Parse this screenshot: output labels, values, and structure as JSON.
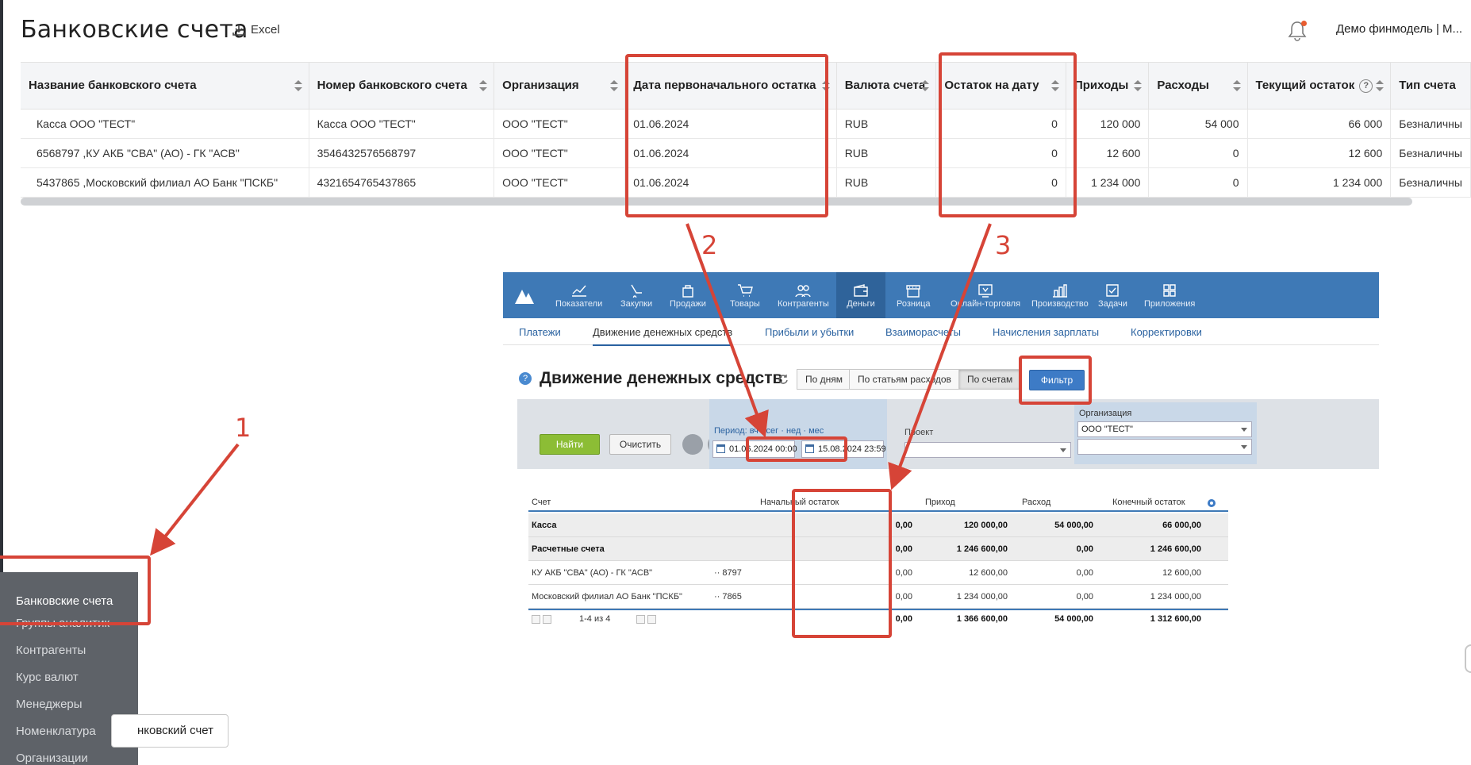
{
  "header": {
    "title": "Банковские счета",
    "excel_label": "Excel",
    "user": "Демо финмодель | М..."
  },
  "accounts_table": {
    "columns": [
      "Название банковского счета",
      "Номер банковского счета",
      "Организация",
      "Дата первоначального остатка",
      "Валюта счета",
      "Остаток на дату",
      "Приходы",
      "Расходы",
      "Текущий остаток",
      "Тип счета"
    ],
    "rows": [
      [
        "Касса ООО \"ТЕСТ\"",
        "Касса ООО \"ТЕСТ\"",
        "ООО \"ТЕСТ\"",
        "01.06.2024",
        "RUB",
        "0",
        "120 000",
        "54 000",
        "66 000",
        "Безналичны"
      ],
      [
        "6568797 ,КУ АКБ \"СВА\" (АО) - ГК \"АСВ\"",
        "3546432576568797",
        "ООО \"ТЕСТ\"",
        "01.06.2024",
        "RUB",
        "0",
        "12 600",
        "0",
        "12 600",
        "Безналичны"
      ],
      [
        "5437865 ,Московский филиал АО Банк \"ПСКБ\"",
        "4321654765437865",
        "ООО \"ТЕСТ\"",
        "01.06.2024",
        "RUB",
        "0",
        "1 234 000",
        "0",
        "1 234 000",
        "Безналичны"
      ]
    ]
  },
  "annotations": {
    "n1": "1",
    "n2": "2",
    "n3": "3"
  },
  "app": {
    "nav": [
      "Показатели",
      "Закупки",
      "Продажи",
      "Товары",
      "Контрагенты",
      "Деньги",
      "Розница",
      "Онлайн-торговля",
      "Производство",
      "Задачи",
      "Приложения"
    ],
    "tabs": [
      "Платежи",
      "Движение денежных средств",
      "Прибыли и убытки",
      "Взаиморасчеты",
      "Начисления зарплаты",
      "Корректировки"
    ],
    "title": "Движение денежных средств",
    "segments": [
      "По дням",
      "По статьям расходов",
      "По счетам"
    ],
    "filter_button": "Фильтр",
    "find_button": "Найти",
    "clear_button": "Очистить",
    "period_label": "Период: вч · сег · нед · мес",
    "date_from": "01.06.2024 00:00",
    "date_to": "15.08.2024 23:59",
    "project_label": "Проект",
    "org_label": "Организация",
    "org_value": "ООО \"ТЕСТ\"",
    "table": {
      "headers": [
        "Счет",
        "Начальный остаток",
        "Приход",
        "Расход",
        "Конечный остаток"
      ],
      "rows": [
        {
          "name": "Касса",
          "acc": "",
          "start": "0,00",
          "in": "120 000,00",
          "out": "54 000,00",
          "end": "66 000,00"
        },
        {
          "name": "Расчетные счета",
          "acc": "",
          "start": "0,00",
          "in": "1 246 600,00",
          "out": "0,00",
          "end": "1 246 600,00"
        },
        {
          "name": "КУ АКБ \"СВА\" (АО) - ГК \"АСВ\"",
          "acc": "·· 8797",
          "start": "0,00",
          "in": "12 600,00",
          "out": "0,00",
          "end": "12 600,00"
        },
        {
          "name": "Московский филиал АО Банк \"ПСКБ\"",
          "acc": "·· 7865",
          "start": "0,00",
          "in": "1 234 000,00",
          "out": "0,00",
          "end": "1 234 000,00"
        }
      ],
      "pager": "1-4 из 4",
      "totals": {
        "start": "0,00",
        "in": "1 366 600,00",
        "out": "54 000,00",
        "end": "1 312 600,00"
      }
    }
  },
  "side_menu": {
    "items": [
      "Банковские счета",
      "Группы аналитик",
      "Контрагенты",
      "Курс валют",
      "Менеджеры",
      "Номенклатура",
      "Организации"
    ]
  },
  "bottom_button": "нковский счет",
  "colors": {
    "accent_red": "#d64437",
    "nav_blue": "#3e79b6",
    "menu_bg": "#5e6268"
  }
}
